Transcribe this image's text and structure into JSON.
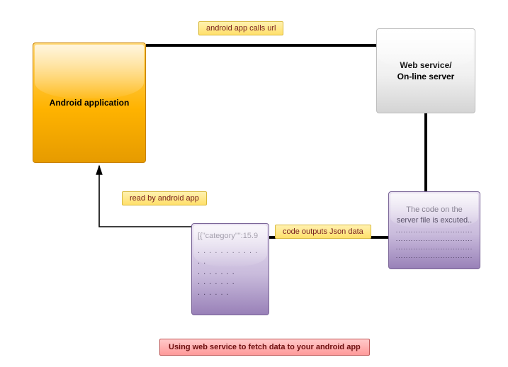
{
  "nodes": {
    "android": "Android application",
    "server_line1": "Web service/",
    "server_line2": "On-line server",
    "json_line1": "[{\"category\"\":15.9",
    "dots_long": ". . . . . . . . . . . . .",
    "dots_med": ". . . . . . .",
    "dots_short": ". . . . . .",
    "serverfile_line1": "The code on the",
    "serverfile_line2": "server file is excuted..",
    "sdots": "..............................."
  },
  "labels": {
    "call": "android app calls url",
    "read": "read by android app",
    "output": "code outputs Json data"
  },
  "caption": "Using web service to fetch data to your android app"
}
